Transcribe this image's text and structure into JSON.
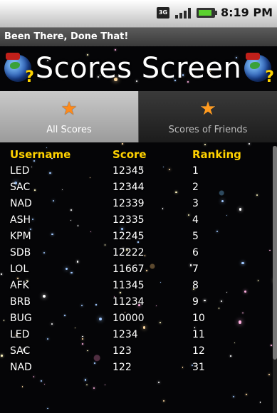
{
  "status": {
    "time": "8:19 PM",
    "network": "3G"
  },
  "app_title": "Been There, Done That!",
  "banner": {
    "title": "Scores Screen",
    "globe_icon": "globe-question-icon"
  },
  "tabs": [
    {
      "label": "All Scores",
      "icon": "star-icon",
      "active": true
    },
    {
      "label": "Scores of Friends",
      "icon": "star-icon",
      "active": false
    }
  ],
  "table": {
    "headers": [
      "Username",
      "Score",
      "Ranking"
    ],
    "rows": [
      [
        "LED",
        "12345",
        "1"
      ],
      [
        "SAC",
        "12344",
        "2"
      ],
      [
        "NAD",
        "12339",
        "3"
      ],
      [
        "ASH",
        "12335",
        "4"
      ],
      [
        "KPM",
        "12245",
        "5"
      ],
      [
        "SDB",
        "12222",
        "6"
      ],
      [
        "LOL",
        "11667",
        "7"
      ],
      [
        "AFK",
        "11345",
        "8"
      ],
      [
        "BRB",
        "11234",
        "9"
      ],
      [
        "BUG",
        "10000",
        "10"
      ],
      [
        "LED",
        "1234",
        "11"
      ],
      [
        "SAC",
        "123",
        "12"
      ],
      [
        "NAD",
        "122",
        "31"
      ]
    ]
  },
  "colors": {
    "header_text": "#ffd200",
    "tab_icon": "#ff8a1a"
  }
}
